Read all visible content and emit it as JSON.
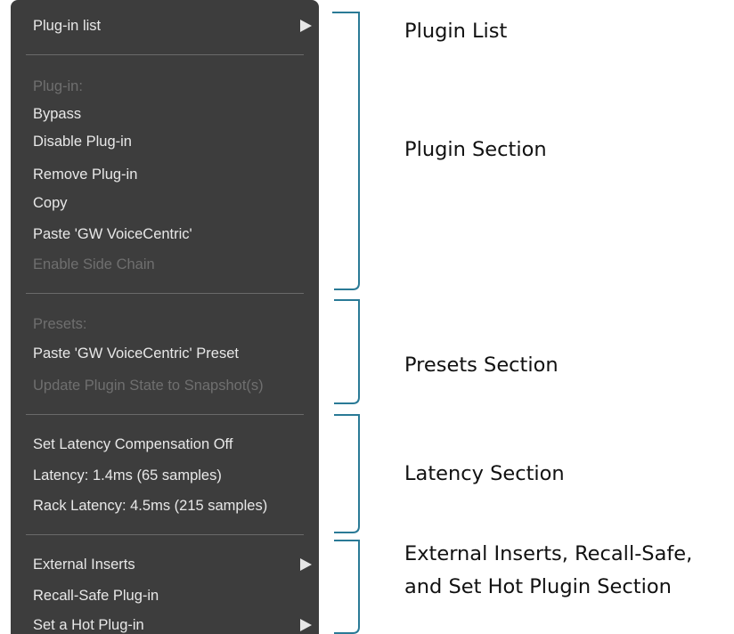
{
  "menu": {
    "plugin_list": "Plug-in list",
    "plugin_header": "Plug-in:",
    "bypass": "Bypass",
    "disable_plugin": "Disable Plug-in",
    "remove_plugin": "Remove Plug-in",
    "copy": "Copy",
    "paste": "Paste 'GW VoiceCentric'",
    "enable_side_chain": "Enable Side Chain",
    "presets_header": "Presets:",
    "paste_preset": "Paste 'GW VoiceCentric' Preset",
    "update_state": "Update Plugin State to Snapshot(s)",
    "set_latency_comp": "Set Latency Compensation Off",
    "latency": "Latency: 1.4ms (65 samples)",
    "rack_latency": "Rack Latency: 4.5ms (215 samples)",
    "external_inserts": "External Inserts",
    "recall_safe": "Recall-Safe Plug-in",
    "hot_plugin": "Set a Hot Plug-in"
  },
  "labels": {
    "plugin_list": "Plugin List",
    "plugin_section": "Plugin Section",
    "presets_section": "Presets Section",
    "latency_section": "Latency Section",
    "external_line1": "External Inserts, Recall-Safe,",
    "external_line2": "and Set Hot Plugin Section"
  },
  "colors": {
    "menu_bg": "#3d3d3d",
    "menu_text": "#e8e8e8",
    "disabled_text": "#6f6f6f",
    "bracket": "#2a7a96"
  }
}
